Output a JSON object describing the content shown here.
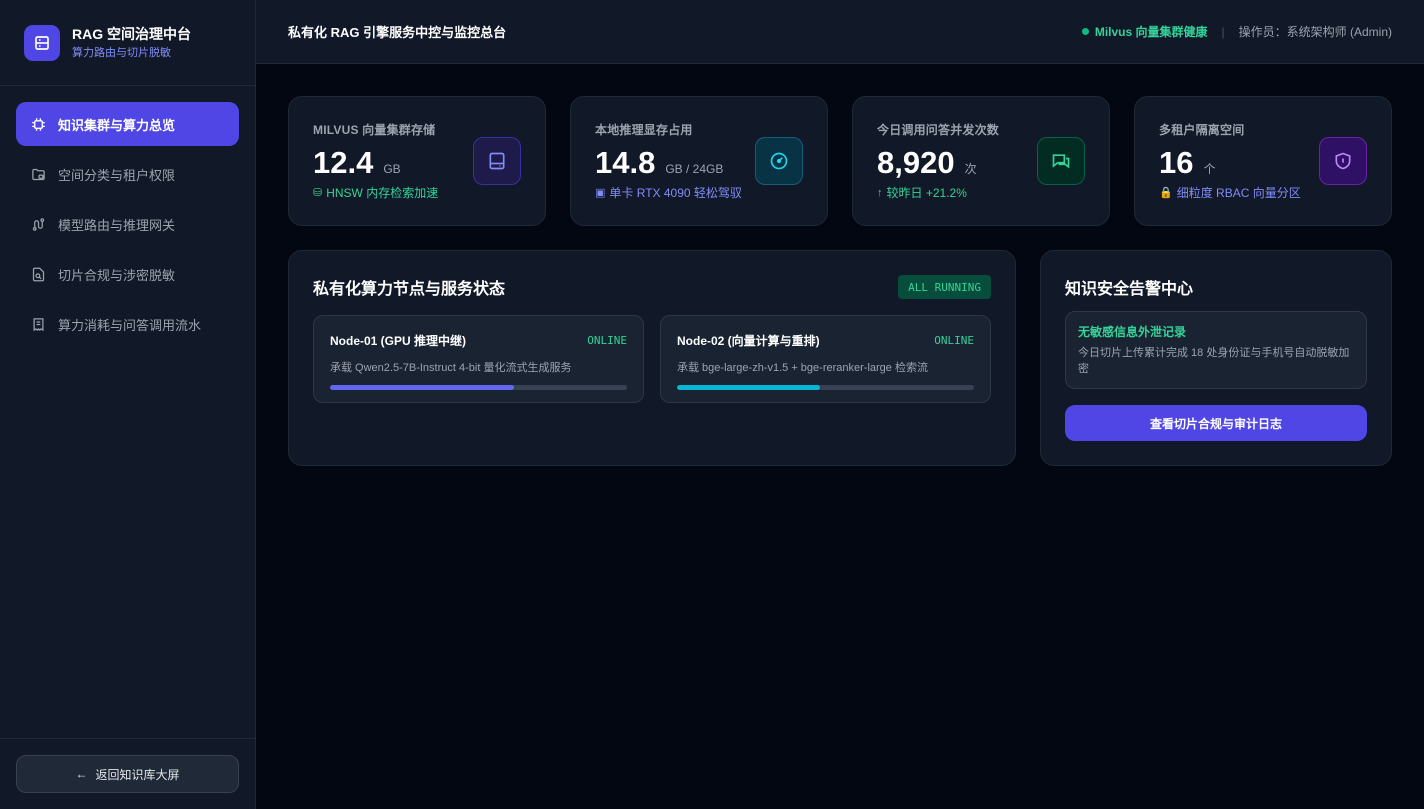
{
  "brand": {
    "title": "RAG 空间治理中台",
    "subtitle": "算力路由与切片脱敏"
  },
  "sidebar": {
    "items": [
      {
        "label": "知识集群与算力总览",
        "icon": "chip-icon",
        "active": true
      },
      {
        "label": "空间分类与租户权限",
        "icon": "folder-lock-icon",
        "active": false
      },
      {
        "label": "模型路由与推理网关",
        "icon": "route-icon",
        "active": false
      },
      {
        "label": "切片合规与涉密脱敏",
        "icon": "file-scan-icon",
        "active": false
      },
      {
        "label": "算力消耗与问答调用流水",
        "icon": "receipt-icon",
        "active": false
      }
    ],
    "back_label": "返回知识库大屏"
  },
  "header": {
    "title": "私有化 RAG 引擎服务中控与监控总台",
    "health": "Milvus 向量集群健康",
    "separator": "|",
    "operator": "操作员：系统架构师 (Admin)"
  },
  "stats": [
    {
      "label": "MILVUS 向量集群存储",
      "value": "12.4",
      "unit": "GB",
      "note_icon": "⛁",
      "note": "HNSW 内存检索加速",
      "note_color": "#34d399",
      "icon": "hard-drive-icon",
      "accent": "#818cf8"
    },
    {
      "label": "本地推理显存占用",
      "value": "14.8",
      "unit": "GB / 24GB",
      "note_icon": "▣",
      "note": "单卡 RTX 4090 轻松驾驭",
      "note_color": "#818cf8",
      "icon": "gauge-icon",
      "accent": "#22d3ee"
    },
    {
      "label": "今日调用问答并发次数",
      "value": "8,920",
      "unit": "次",
      "note_icon": "↑",
      "note": "较昨日 +21.2%",
      "note_color": "#34d399",
      "icon": "chat-icon",
      "accent": "#34d399"
    },
    {
      "label": "多租户隔离空间",
      "value": "16",
      "unit": "个",
      "note_icon": "🔒",
      "note": "细粒度 RBAC 向量分区",
      "note_color": "#818cf8",
      "icon": "shield-icon",
      "accent": "#c084fc"
    }
  ],
  "nodes_panel": {
    "title": "私有化算力节点与服务状态",
    "badge": "ALL RUNNING",
    "nodes": [
      {
        "name": "Node-01 (GPU 推理中继)",
        "status": "ONLINE",
        "desc": "承载 Qwen2.5-7B-Instruct 4-bit 量化流式生成服务",
        "load": 0.62,
        "color": "#6366f1"
      },
      {
        "name": "Node-02 (向量计算与重排)",
        "status": "ONLINE",
        "desc": "承载 bge-large-zh-v1.5 + bge-reranker-large 检索流",
        "load": 0.48,
        "color": "#06b6d4"
      }
    ]
  },
  "alert_panel": {
    "title": "知识安全告警中心",
    "alert_title": "无敏感信息外泄记录",
    "alert_desc": "今日切片上传累计完成 18 处身份证与手机号自动脱敏加密",
    "button": "查看切片合规与审计日志"
  }
}
